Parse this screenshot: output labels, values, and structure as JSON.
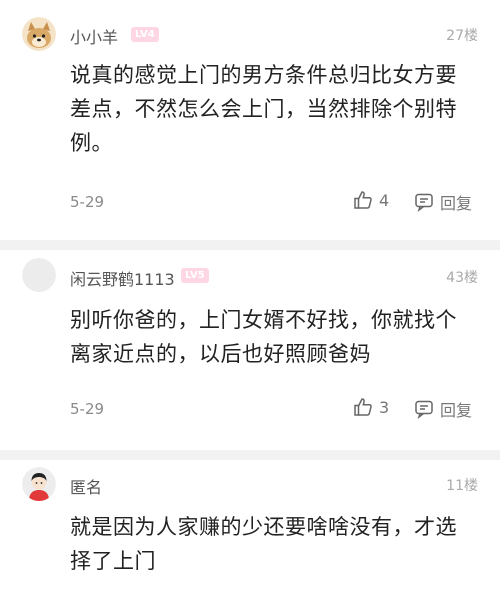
{
  "comments": [
    {
      "username": "小小羊",
      "level": "LV4",
      "floor": "27楼",
      "content": "说真的感觉上门的男方条件总归比女方要差点，不然怎么会上门，当然排除个别特例。",
      "date": "5-29",
      "likes": "4",
      "reply_label": "回复",
      "avatar_icon": "doge-avatar-icon"
    },
    {
      "username": "闲云野鹤1113",
      "level": "LV5",
      "floor": "43楼",
      "content": "别听你爸的，上门女婿不好找，你就找个离家近点的，以后也好照顾爸妈",
      "date": "5-29",
      "likes": "3",
      "reply_label": "回复",
      "avatar_icon": "default-avatar-icon"
    },
    {
      "username": "匿名",
      "level": "",
      "floor": "11楼",
      "content": "就是因为人家赚的少还要啥啥没有，才选择了上门",
      "date": "",
      "likes": "",
      "reply_label": "",
      "avatar_icon": "anonymous-avatar-icon"
    }
  ],
  "colors": {
    "level_badge": "#ffd6e3",
    "divider": "#f2f2f2",
    "meta_text": "#8a8a8a"
  }
}
